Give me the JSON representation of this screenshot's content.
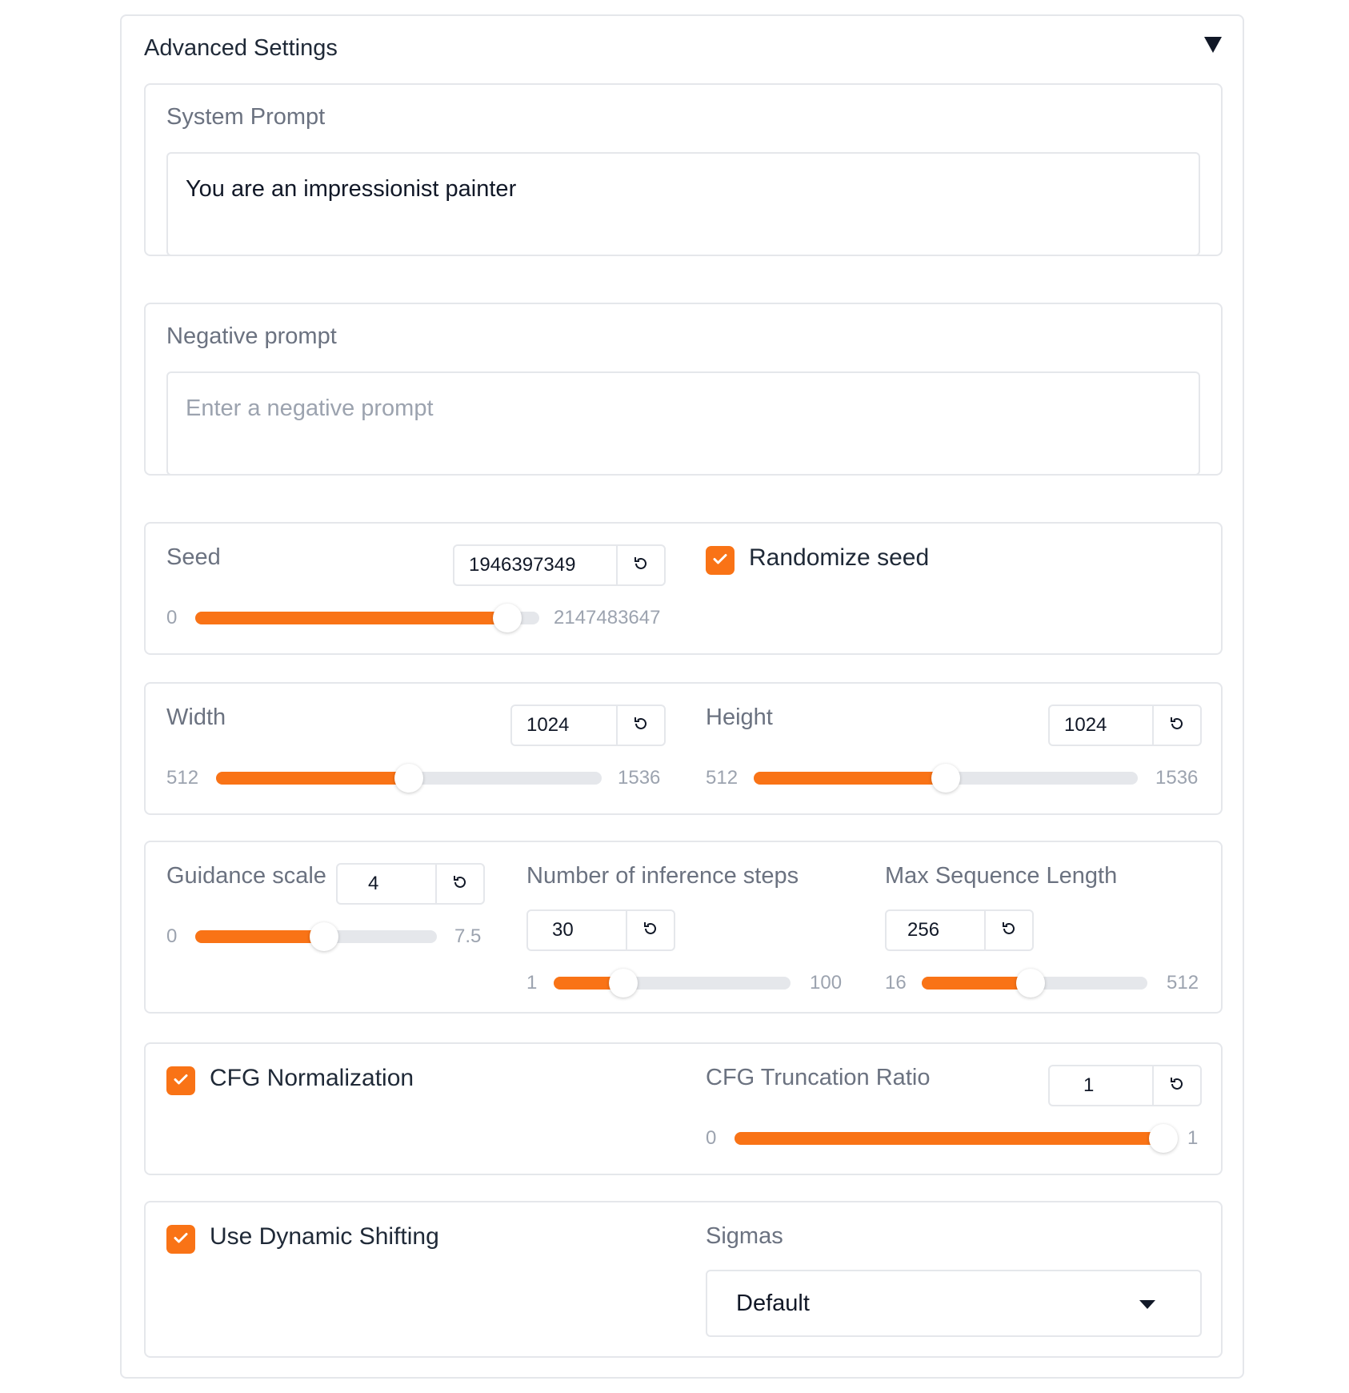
{
  "panel": {
    "title": "Advanced Settings",
    "collapse_icon": "triangle-down-icon"
  },
  "system_prompt": {
    "label": "System Prompt",
    "value": "You are an impressionist painter"
  },
  "negative_prompt": {
    "label": "Negative prompt",
    "placeholder": "Enter a negative prompt"
  },
  "seed": {
    "label": "Seed",
    "value": "1946397349",
    "min": "0",
    "max": "2147483647",
    "fraction": 0.906,
    "reset_icon": "reset-icon"
  },
  "randomize_seed": {
    "label": "Randomize seed",
    "checked": true
  },
  "width": {
    "label": "Width",
    "value": "1024",
    "min": "512",
    "max": "1536",
    "fraction": 0.5
  },
  "height": {
    "label": "Height",
    "value": "1024",
    "min": "512",
    "max": "1536",
    "fraction": 0.5
  },
  "guidance_scale": {
    "label": "Guidance scale",
    "value": "4",
    "min": "0",
    "max": "7.5",
    "fraction": 0.533
  },
  "inference_steps": {
    "label": "Number of inference steps",
    "value": "30",
    "min": "1",
    "max": "100",
    "fraction": 0.293
  },
  "max_seq_length": {
    "label": "Max Sequence Length",
    "value": "256",
    "min": "16",
    "max": "512",
    "fraction": 0.484
  },
  "cfg_normalization": {
    "label": "CFG Normalization",
    "checked": true
  },
  "cfg_truncation": {
    "label": "CFG Truncation Ratio",
    "value": "1",
    "min": "0",
    "max": "1",
    "fraction": 1.0
  },
  "dynamic_shifting": {
    "label": "Use Dynamic Shifting",
    "checked": true
  },
  "sigmas": {
    "label": "Sigmas",
    "selected": "Default"
  },
  "colors": {
    "accent": "#f97316",
    "border": "#e5e7eb",
    "label": "#6b7280",
    "muted": "#9ca3af"
  }
}
